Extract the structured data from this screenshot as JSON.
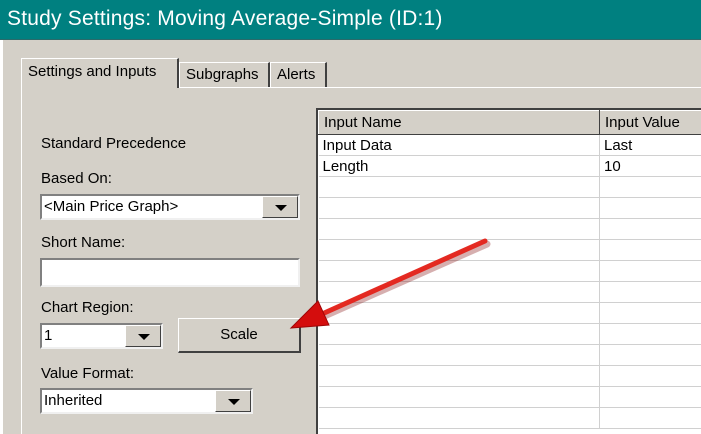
{
  "window": {
    "title": "Study Settings: Moving Average-Simple (ID:1)"
  },
  "tabs": [
    {
      "label": "Settings and Inputs",
      "active": true
    },
    {
      "label": "Subgraphs",
      "active": false
    },
    {
      "label": "Alerts",
      "active": false
    }
  ],
  "settings": {
    "standard_precedence": "Standard Precedence",
    "based_on_label": "Based On:",
    "based_on_value": "<Main Price Graph>",
    "short_name_label": "Short Name:",
    "short_name_value": "",
    "chart_region_label": "Chart Region:",
    "chart_region_value": "1",
    "scale_button": "Scale",
    "value_format_label": "Value Format:",
    "value_format_value": "Inherited"
  },
  "inputs_grid": {
    "headers": [
      "Input Name",
      "Input Value"
    ],
    "rows": [
      [
        "Input Data",
        "Last"
      ],
      [
        "Length",
        "10"
      ]
    ]
  },
  "icons": {
    "dropdown": "chevron-down-icon",
    "annotation": "red-arrow-annotation"
  },
  "colors": {
    "titlebar": "#008080",
    "dialog": "#d4d0c8",
    "arrow": "#e01010"
  }
}
